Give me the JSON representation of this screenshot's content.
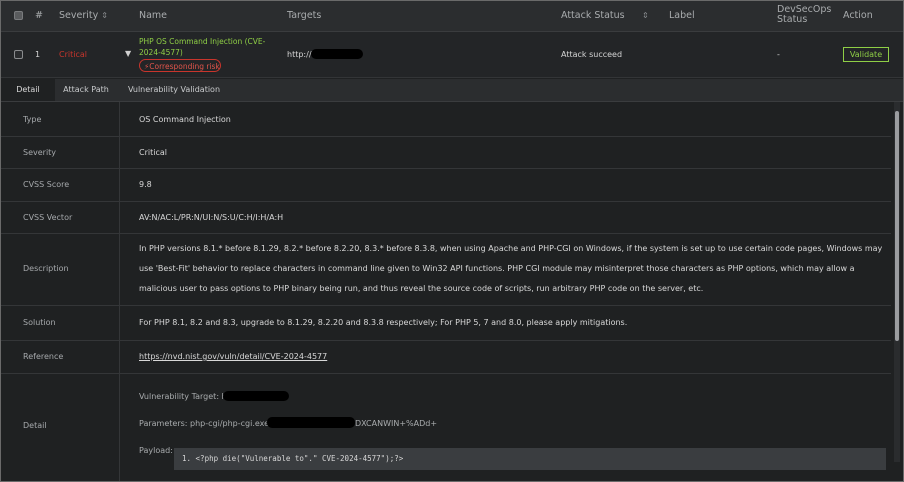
{
  "table": {
    "headers": {
      "index": "#",
      "severity": "Severity",
      "name": "Name",
      "targets": "Targets",
      "attack_status": "Attack Status",
      "label": "Label",
      "devsecops_status": "DevSecOps Status",
      "action": "Action"
    },
    "row": {
      "index": "1",
      "severity": "Critical",
      "name_line1": "PHP OS Command Injection (CVE-",
      "name_line2": "2024-4577)",
      "badge": "Corresponding risk",
      "target": "http://",
      "attack_status": "Attack succeed",
      "devsecops_status": "-",
      "action_label": "Validate"
    }
  },
  "tabs": [
    "Detail",
    "Attack Path",
    "Vulnerability Validation"
  ],
  "detail": {
    "type_label": "Type",
    "type_value": "OS Command Injection",
    "severity_label": "Severity",
    "severity_value": "Critical",
    "cvss_score_label": "CVSS Score",
    "cvss_score_value": "9.8",
    "cvss_vector_label": "CVSS Vector",
    "cvss_vector_value": "AV:N/AC:L/PR:N/UI:N/S:U/C:H/I:H/A:H",
    "description_label": "Description",
    "description_value": "In PHP versions 8.1.* before 8.1.29, 8.2.* before 8.2.20, 8.3.* before 8.3.8, when using Apache and PHP-CGI on Windows, if the system is set up to use certain code pages, Windows may use 'Best-Fit' behavior to replace characters in command line given to Win32 API functions. PHP CGI module may misinterpret those characters as PHP options, which may allow a malicious user to pass options to PHP binary being run, and thus reveal the source code of scripts, run arbitrary PHP code on the server, etc.",
    "solution_label": "Solution",
    "solution_value": "For PHP 8.1, 8.2 and 8.3, upgrade to 8.1.29, 8.2.20 and 8.3.8 respectively; For PHP 5, 7 and 8.0, please apply mitigations.",
    "reference_label": "Reference",
    "reference_value": "https://nvd.nist.gov/vuln/detail/CVE-2024-4577",
    "detail_label": "Detail",
    "vuln_target": "Vulnerability Target: http://",
    "parameters_prefix": "Parameters: php-cgi/php-cgi.exe?%",
    "parameters_suffix": "DXCANWIN+%ADd+",
    "payload_label": "Payload:",
    "payload_value": "1. <?php die(\"Vulnerable to\".\" CVE-2024-4577\");?>"
  },
  "colors": {
    "critical": "#c8352c",
    "accent_green": "#8fcf46"
  }
}
